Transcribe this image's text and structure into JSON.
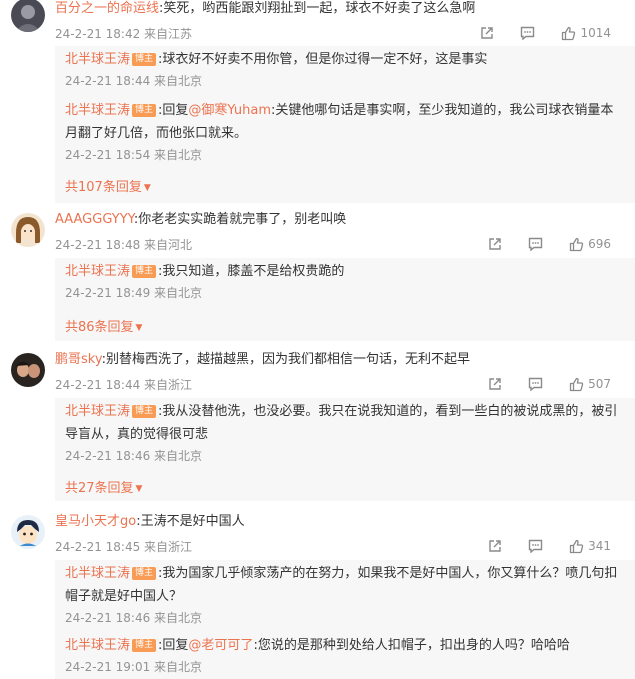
{
  "threads": [
    {
      "user": "百分之一的命运线",
      "text": ":笑死，哟西能跟刘翔扯到一起，球衣不好卖了这么急啊",
      "meta": "24-2-21 18:42 来自江苏",
      "likes": "1014",
      "replies": [
        {
          "user": "北半球王涛",
          "badge": "博主",
          "text": ":球衣好不好卖不用你管，但是你过得一定不好，这是事实",
          "meta": "24-2-21 18:44 来自北京"
        },
        {
          "user": "北半球王涛",
          "badge": "博主",
          "text_prefix": ":回复",
          "at": "@御寒Yuham",
          "text": ":关键他哪句话是事实啊，至少我知道的，我公司球衣销量本月翻了好几倍，而他张口就来。",
          "meta": "24-2-21 18:54 来自北京"
        }
      ],
      "more": "共107条回复"
    },
    {
      "user": "AAAGGGYYY",
      "text": ":你老老实实跪着就完事了，别老叫唤",
      "meta": "24-2-21 18:48 来自河北",
      "likes": "696",
      "replies": [
        {
          "user": "北半球王涛",
          "badge": "博主",
          "text": ":我只知道，膝盖不是给权贵跪的",
          "meta": "24-2-21 18:49 来自北京"
        }
      ],
      "more": "共86条回复"
    },
    {
      "user": "鹏哥sky",
      "text": ":别替梅西洗了，越描越黑，因为我们都相信一句话，无利不起早",
      "meta": "24-2-21 18:44 来自浙江",
      "likes": "507",
      "replies": [
        {
          "user": "北半球王涛",
          "badge": "博主",
          "text": ":我从没替他洗，也没必要。我只在说我知道的，看到一些白的被说成黑的，被引导盲从，真的觉得很可悲",
          "meta": "24-2-21 18:46 来自北京"
        }
      ],
      "more": "共27条回复"
    },
    {
      "user": "皇马小天才go",
      "text": ":王涛不是好中国人",
      "meta": "24-2-21 18:45 来自浙江",
      "likes": "341",
      "replies": [
        {
          "user": "北半球王涛",
          "badge": "博主",
          "text": ":我为国家几乎倾家荡产的在努力，如果我不是好中国人，你又算什么？喷几句扣帽子就是好中国人？",
          "meta": "24-2-21 18:46 来自北京"
        },
        {
          "user": "北半球王涛",
          "badge": "博主",
          "text_prefix": ":回复",
          "at": "@老可可了",
          "text": ":您说的是那种到处给人扣帽子，扣出身的人吗？哈哈哈",
          "meta": "24-2-21 19:01 来自北京"
        }
      ]
    }
  ],
  "icons": {
    "share": "share-icon",
    "comment": "comment-icon",
    "like": "thumbs-up-icon",
    "more": "triangle-down-icon"
  },
  "colors": {
    "username": "#eb7350",
    "badge": "#f89b55",
    "meta": "#939393",
    "reply_bg": "#f7f7f7"
  }
}
